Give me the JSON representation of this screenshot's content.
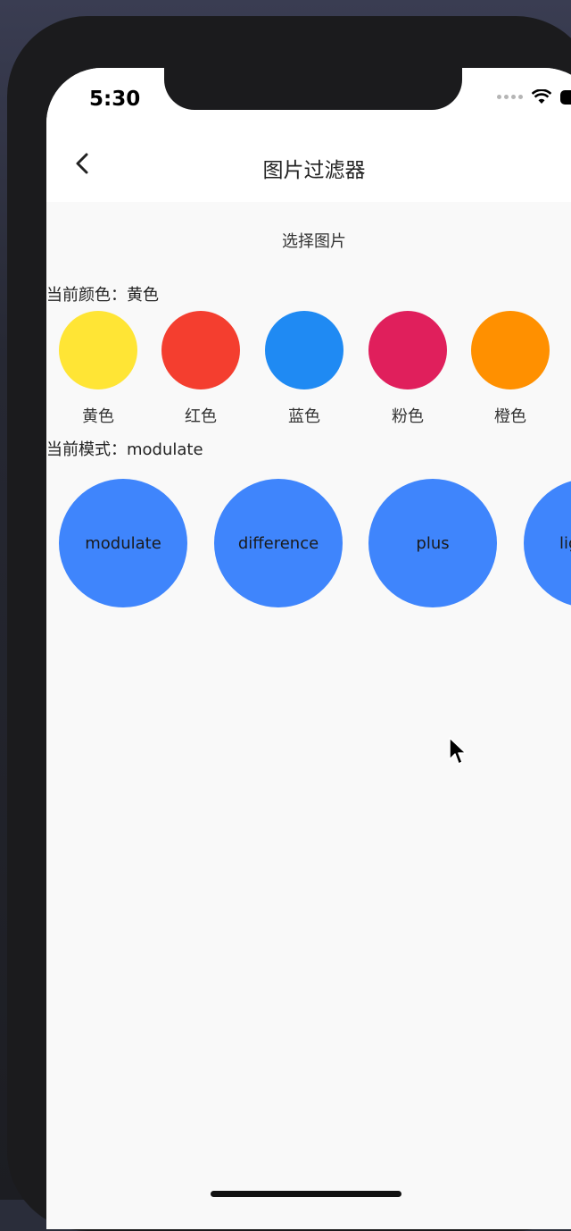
{
  "status_bar": {
    "time": "5:30"
  },
  "nav": {
    "title": "图片过滤器"
  },
  "select_image_label": "选择图片",
  "current_color": {
    "prefix": "当前颜色：",
    "value": "黄色"
  },
  "colors": [
    {
      "label": "黄色",
      "hex": "#ffe535"
    },
    {
      "label": "红色",
      "hex": "#f43e2f"
    },
    {
      "label": "蓝色",
      "hex": "#1f8af3"
    },
    {
      "label": "粉色",
      "hex": "#e01f5c"
    },
    {
      "label": "橙色",
      "hex": "#ff9000"
    }
  ],
  "current_mode": {
    "prefix": "当前模式：",
    "value": "modulate"
  },
  "modes": [
    "modulate",
    "difference",
    "plus",
    "lig"
  ],
  "accent_color": "#3f85fc"
}
